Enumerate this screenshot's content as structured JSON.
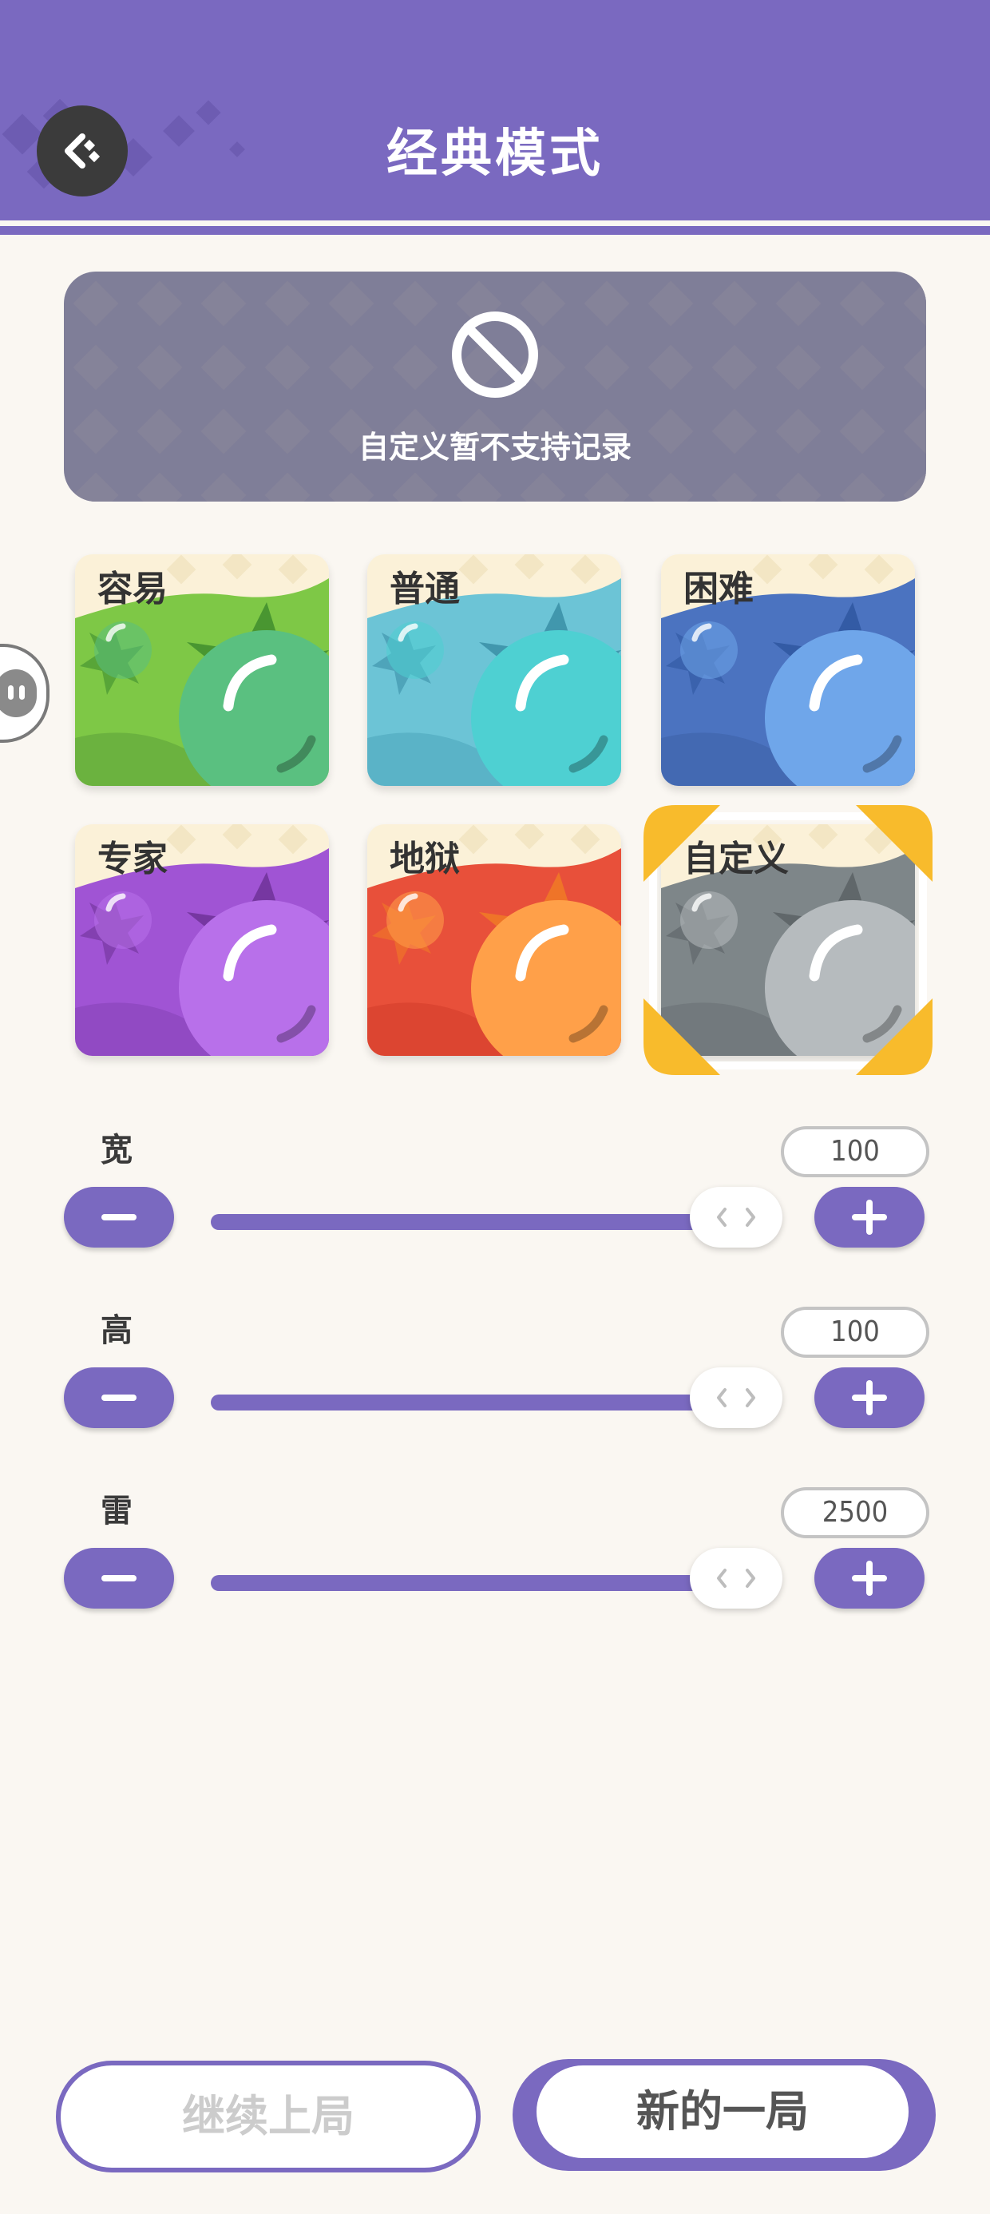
{
  "header": {
    "title": "经典模式",
    "back_icon": "back-icon"
  },
  "notice": {
    "icon": "ban-icon",
    "text": "自定义暂不支持记录"
  },
  "side_handle_icon": "ghost-icon",
  "difficulty": {
    "selected": "自定义",
    "cards": [
      {
        "label": "容易",
        "bg": "#7ec846",
        "band": "#5fa33a",
        "orb": "#5ac080",
        "spike": "#3f8d2e"
      },
      {
        "label": "普通",
        "bg": "#6cc4d6",
        "band": "#4fa9bd",
        "orb": "#4ed0d2",
        "spike": "#3a8fa6"
      },
      {
        "label": "困难",
        "bg": "#4b73c0",
        "band": "#3d62a8",
        "orb": "#6fa6ea",
        "spike": "#2f57a0"
      },
      {
        "label": "专家",
        "bg": "#a054d4",
        "band": "#8744b8",
        "orb": "#b870ea",
        "spike": "#6f3398"
      },
      {
        "label": "地狱",
        "bg": "#e8503a",
        "band": "#d43e2c",
        "orb": "#ffa049",
        "spike": "#f07a26"
      },
      {
        "label": "自定义",
        "bg": "#7e8689",
        "band": "#6a7275",
        "orb": "#b6bbbe",
        "spike": "#5b6265"
      }
    ]
  },
  "sliders": [
    {
      "label": "宽",
      "value": "100",
      "fill_fraction": 1.0
    },
    {
      "label": "高",
      "value": "100",
      "fill_fraction": 1.0
    },
    {
      "label": "雷",
      "value": "2500",
      "fill_fraction": 1.0
    }
  ],
  "buttons": {
    "continue_label": "继续上局",
    "new_game_label": "新的一局"
  },
  "colors": {
    "accent": "#7a69c0",
    "background": "#faf7f2",
    "selected_corner": "#f8bb2c"
  }
}
